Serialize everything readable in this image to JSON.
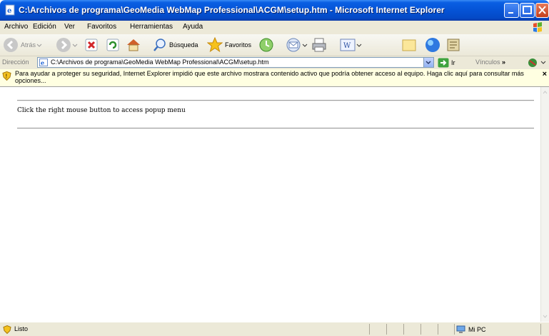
{
  "window": {
    "title": "C:\\Archivos de programa\\GeoMedia WebMap Professional\\ACGM\\setup.htm - Microsoft Internet Explorer"
  },
  "menu": [
    "Archivo",
    "Edición",
    "Ver",
    "Favoritos",
    "Herramientas",
    "Ayuda"
  ],
  "toolbar": {
    "back_label": "Atrás",
    "search_label": "Búsqueda",
    "favorites_label": "Favoritos"
  },
  "address": {
    "label": "Dirección",
    "url": "C:\\Archivos de programa\\GeoMedia WebMap Professional\\ACGM\\setup.htm",
    "go_label": "Ir",
    "links_label": "Vínculos"
  },
  "infobar": {
    "message": "Para ayudar a proteger su seguridad, Internet Explorer impidió que este archivo mostrara contenido activo que podría obtener acceso al equipo. Haga clic aquí para consultar más opciones...",
    "close": "×"
  },
  "page": {
    "text": "Click the right mouse button to access popup menu"
  },
  "status": {
    "text": "Listo",
    "zone": "Mi PC"
  }
}
